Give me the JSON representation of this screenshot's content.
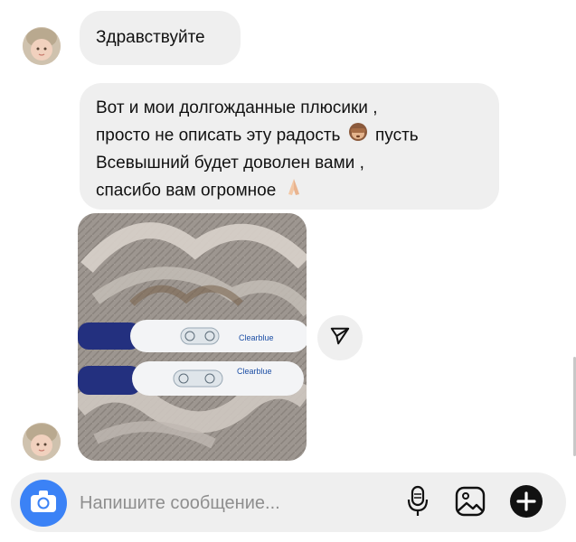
{
  "messages": {
    "greeting": "Здравствуйте",
    "long_text": {
      "line1": "Вот и мои долгожданные плюсики ,",
      "line2_a": "просто не описать эту радость",
      "line2_b": "пусть",
      "line3": "Всевышний будет доволен вами ,",
      "line4": "спасибо вам огромное"
    },
    "photo": {
      "test_brand_1": "Clearblue",
      "test_brand_2": "Clearblue",
      "icons": [
        "see-no-evil-monkey-emoji",
        "folded-hands-emoji"
      ]
    }
  },
  "actions": {
    "share_icon": "paper-plane-icon"
  },
  "composer": {
    "placeholder": "Напишите сообщение...",
    "icons": [
      "camera-icon",
      "microphone-icon",
      "gallery-icon",
      "plus-icon"
    ]
  },
  "colors": {
    "bubble": "#efefef",
    "camera_button": "#3b82f6",
    "placeholder": "#8e8e8e"
  }
}
